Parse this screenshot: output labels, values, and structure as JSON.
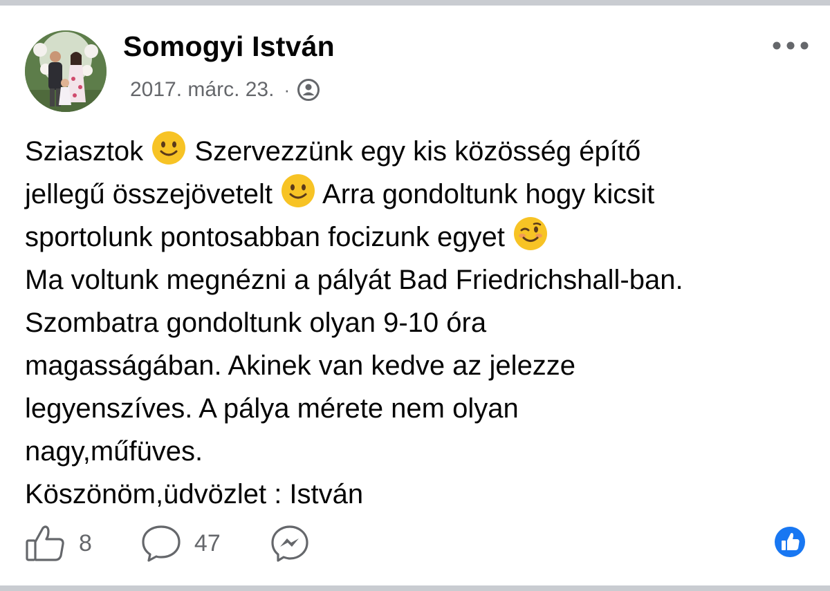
{
  "post": {
    "author": "Somogyi István",
    "date": "2017. márc. 23.",
    "separator": "·",
    "audience_icon": "friends-icon",
    "lines": [
      {
        "parts": [
          "Sziasztok ",
          " Szervezzünk egy kis közösség építő"
        ],
        "emoji": "slightly-smiling-face"
      },
      {
        "parts": [
          "jellegű összejövetelt ",
          " Arra gondoltunk hogy kicsit"
        ],
        "emoji": "slightly-smiling-face"
      },
      {
        "parts": [
          "sportolunk pontosabban focizunk egyet ",
          ""
        ],
        "emoji": "winking-face"
      },
      {
        "text": "Ma voltunk megnézni a pályát Bad Friedrichshall-ban."
      },
      {
        "text": "Szombatra gondoltunk olyan 9-10 óra"
      },
      {
        "text": "magasságában. Akinek van kedve az jelezze"
      },
      {
        "text": "legyenszíves. A pálya mérete nem olyan"
      },
      {
        "text": "nagy,műfüves."
      },
      {
        "text": "Köszönöm,üdvözlet : István"
      }
    ]
  },
  "actions": {
    "like_count": "8",
    "comment_count": "47",
    "like_icon": "thumbs-up-icon",
    "comment_icon": "comment-bubble-icon",
    "share_icon": "messenger-icon"
  },
  "colors": {
    "text": "#050505",
    "secondary_text": "#65676b",
    "like_blue": "#1877f2",
    "divider": "#c9ccd1"
  }
}
